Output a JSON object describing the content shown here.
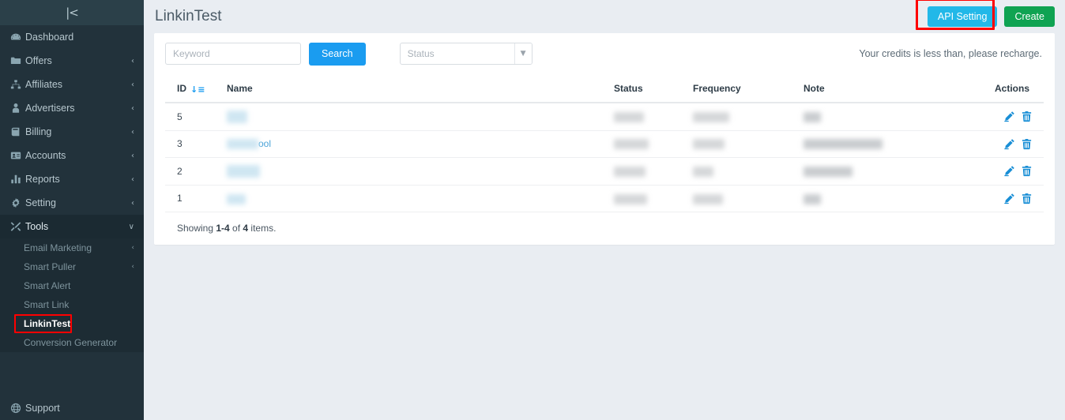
{
  "sidebar": {
    "collapse_icon": "|<",
    "items": [
      {
        "label": "Dashboard",
        "icon": "dashboard-gauge-icon",
        "caret": "",
        "active": false
      },
      {
        "label": "Offers",
        "icon": "folder-icon",
        "caret": "‹",
        "active": false
      },
      {
        "label": "Affiliates",
        "icon": "sitemap-icon",
        "caret": "‹",
        "active": false
      },
      {
        "label": "Advertisers",
        "icon": "user-tie-icon",
        "caret": "‹",
        "active": false
      },
      {
        "label": "Billing",
        "icon": "book-icon",
        "caret": "‹",
        "active": false
      },
      {
        "label": "Accounts",
        "icon": "id-card-icon",
        "caret": "‹",
        "active": false
      },
      {
        "label": "Reports",
        "icon": "bar-chart-icon",
        "caret": "‹",
        "active": false
      },
      {
        "label": "Setting",
        "icon": "gear-icon",
        "caret": "‹",
        "active": false
      },
      {
        "label": "Tools",
        "icon": "tools-icon",
        "caret": "∨",
        "active": true
      }
    ],
    "submenu": [
      {
        "label": "Email Marketing",
        "caret": "‹",
        "selected": false
      },
      {
        "label": "Smart Puller",
        "caret": "‹",
        "selected": false
      },
      {
        "label": "Smart Alert",
        "caret": "",
        "selected": false
      },
      {
        "label": "Smart Link",
        "caret": "",
        "selected": false
      },
      {
        "label": "LinkinTest",
        "caret": "",
        "selected": true
      },
      {
        "label": "Conversion Generator",
        "caret": "",
        "selected": false
      }
    ],
    "bottom": {
      "label": "Support",
      "icon": "globe-icon"
    }
  },
  "header": {
    "title": "LinkinTest",
    "api_setting_label": "API Setting",
    "create_label": "Create"
  },
  "filters": {
    "keyword_value": "",
    "keyword_placeholder": "Keyword",
    "search_label": "Search",
    "status_selected": "Status",
    "status_options": [
      "Status"
    ],
    "credits_notice": "Your credits is less than, please recharge."
  },
  "table": {
    "columns": [
      "ID",
      "Name",
      "Status",
      "Frequency",
      "Note",
      "Actions"
    ],
    "sort_column": "ID",
    "sort_icon": "↓≡",
    "rows": [
      {
        "id": "5",
        "name": "",
        "status": "",
        "frequency": "",
        "note": ""
      },
      {
        "id": "3",
        "name": "ool",
        "status": "",
        "frequency": "",
        "note": ""
      },
      {
        "id": "2",
        "name": "",
        "status": "",
        "frequency": "",
        "note": ""
      },
      {
        "id": "1",
        "name": "",
        "status": "",
        "frequency": "",
        "note": ""
      }
    ],
    "actions": {
      "edit": "edit-icon",
      "delete": "delete-icon"
    }
  },
  "footer": {
    "showing_prefix": "Showing ",
    "showing_range": "1-4",
    "showing_middle": " of ",
    "showing_total": "4",
    "showing_suffix": " items."
  },
  "colors": {
    "sidebar_bg": "#22323b",
    "sidebar_header_bg": "#2b4049",
    "submenu_bg": "#1d2c34",
    "api_button": "#22b8e8",
    "create_button": "#0fa352",
    "search_button": "#1a9cf0",
    "highlight_outline": "#ff0000",
    "action_icon": "#1a8fd6",
    "page_bg": "#e9edf2"
  }
}
